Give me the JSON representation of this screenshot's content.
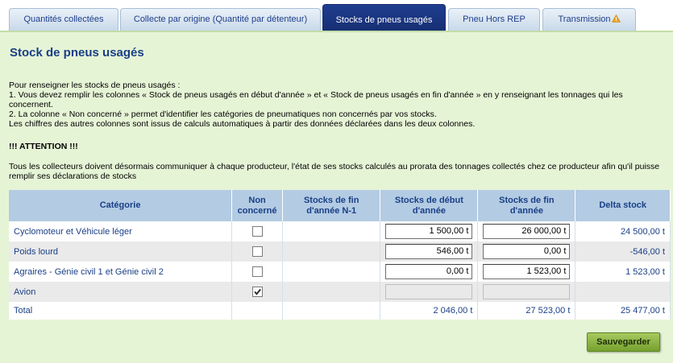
{
  "tabs": [
    {
      "label": "Quantités collectées"
    },
    {
      "label": "Collecte par origine (Quantité par détenteur)"
    },
    {
      "label": "Stocks de pneus usagés"
    },
    {
      "label": "Pneu Hors REP"
    },
    {
      "label": "Transmission"
    }
  ],
  "page": {
    "title": "Stock de pneus usagés",
    "intro_1": "Pour renseigner les stocks de pneus usagés :",
    "intro_2": "1. Vous devez remplir les colonnes « Stock de pneus usagés en début d'année » et « Stock de pneus usagés en fin d'année » en y renseignant les tonnages qui les concernent.",
    "intro_3": "2. La colonne « Non concerné » permet d'identifier les catégories de pneumatiques non concernés par vos stocks.",
    "intro_4": "Les chiffres des autres colonnes sont issus de calculs automatiques à partir des données déclarées dans les deux colonnes.",
    "attention": "!!! ATTENTION !!!",
    "note": "Tous les collecteurs doivent désormais communiquer à chaque producteur, l'état de ses stocks calculés au prorata des tonnages collectés chez ce producteur afin qu'il puisse remplir ses déclarations de stocks"
  },
  "table": {
    "headers": {
      "categorie": "Catégorie",
      "non_concerne": "Non concerné",
      "stocks_fin_n1": "Stocks de fin d'année N-1",
      "stocks_debut": "Stocks de début d'année",
      "stocks_fin": "Stocks de fin d'année",
      "delta": "Delta stock"
    },
    "rows": [
      {
        "categorie": "Cyclomoteur et Véhicule léger",
        "non_concerne": false,
        "stocks_fin_n1": "",
        "stocks_debut": "1 500,00 t",
        "stocks_fin": "26 000,00 t",
        "delta": "24 500,00 t"
      },
      {
        "categorie": "Poids lourd",
        "non_concerne": false,
        "stocks_fin_n1": "",
        "stocks_debut": "546,00 t",
        "stocks_fin": "0,00 t",
        "delta": "-546,00 t"
      },
      {
        "categorie": "Agraires - Génie civil 1 et Génie civil 2",
        "non_concerne": false,
        "stocks_fin_n1": "",
        "stocks_debut": "0,00 t",
        "stocks_fin": "1 523,00 t",
        "delta": "1 523,00 t"
      },
      {
        "categorie": "Avion",
        "non_concerne": true,
        "stocks_fin_n1": "",
        "stocks_debut": "",
        "stocks_fin": "",
        "delta": ""
      }
    ],
    "total": {
      "label": "Total",
      "stocks_debut": "2 046,00 t",
      "stocks_fin": "27 523,00 t",
      "delta": "25 477,00 t"
    }
  },
  "actions": {
    "save_label": "Sauvegarder"
  },
  "colors": {
    "accent": "#1a3f86",
    "panel": "#e6f4d6",
    "header": "#b3cbe3",
    "save": "#8fb646",
    "warning": "#f0a31c"
  }
}
